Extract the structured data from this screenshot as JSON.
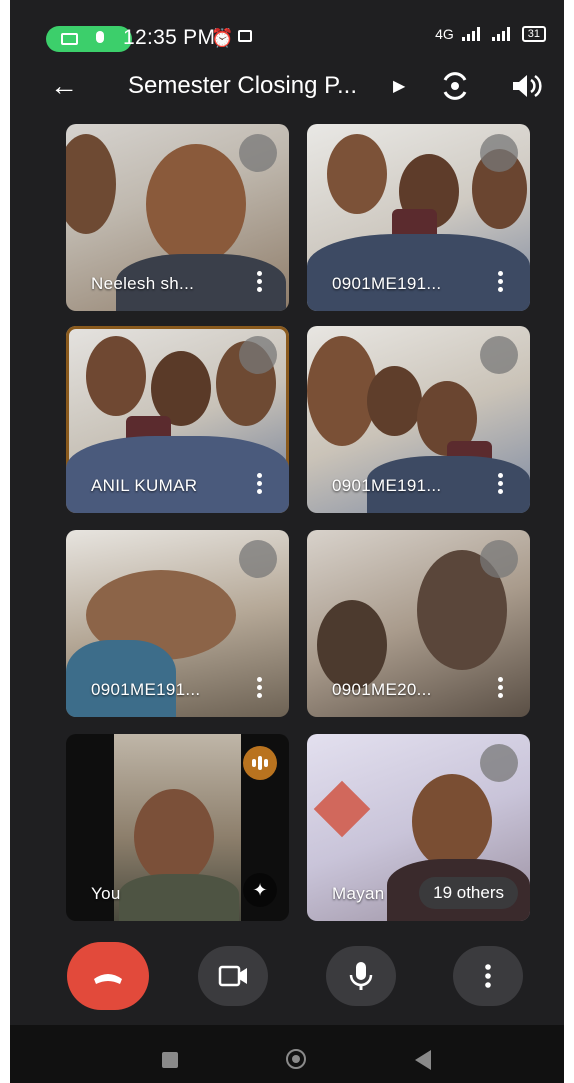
{
  "status_bar": {
    "time": "12:35 PM",
    "network": "4G",
    "battery": "31"
  },
  "header": {
    "title": "Semester Closing P..."
  },
  "participants": [
    {
      "name": "Neelesh sh..."
    },
    {
      "name": "0901ME191..."
    },
    {
      "name": "ANIL KUMAR"
    },
    {
      "name": "0901ME191..."
    },
    {
      "name": "0901ME191..."
    },
    {
      "name": "0901ME20..."
    },
    {
      "name": "You"
    },
    {
      "name": "Mayan"
    }
  ],
  "others_badge": "19 others",
  "colors": {
    "background": "#1f1f21",
    "end_call": "#e24a3b",
    "speaking": "#b9731f",
    "rec_pill": "#3ccf6b",
    "control": "#3b3b3e"
  },
  "icons": [
    "back-arrow-icon",
    "chevron-right-icon",
    "flip-camera-icon",
    "speaker-icon",
    "mic-off-icon",
    "more-vert-icon",
    "speaking-indicator-icon",
    "effects-sparkle-icon",
    "end-call-icon",
    "camera-icon",
    "mic-icon"
  ]
}
